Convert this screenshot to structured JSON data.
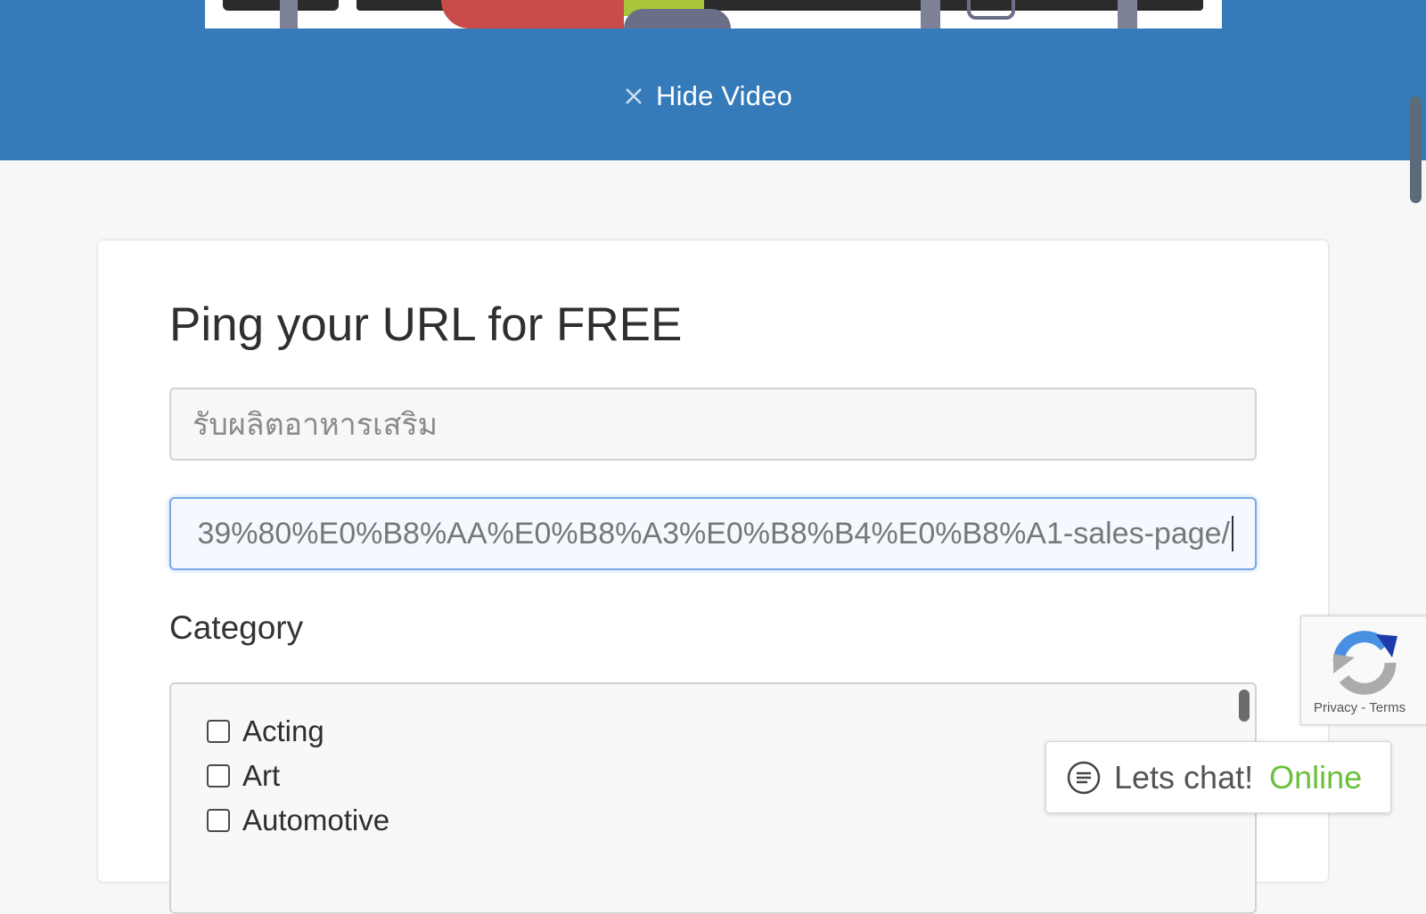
{
  "hide_video": {
    "label": "Hide Video"
  },
  "form": {
    "title": "Ping your URL for FREE",
    "keyword_value": "รับผลิตอาหารเสริม",
    "url_value": "39%80%E0%B8%AA%E0%B8%A3%E0%B8%B4%E0%B8%A1-sales-page/",
    "category_label": "Category",
    "categories": [
      {
        "label": "Acting",
        "checked": false
      },
      {
        "label": "Art",
        "checked": false
      },
      {
        "label": "Automotive",
        "checked": false
      }
    ]
  },
  "recaptcha": {
    "privacy": "Privacy",
    "separator": " - ",
    "terms": "Terms"
  },
  "chat": {
    "text": "Lets chat!",
    "status": "Online",
    "status_color": "#6ac03a"
  },
  "colors": {
    "header_blue": "#357ab9",
    "background": "#f7f7f7"
  }
}
